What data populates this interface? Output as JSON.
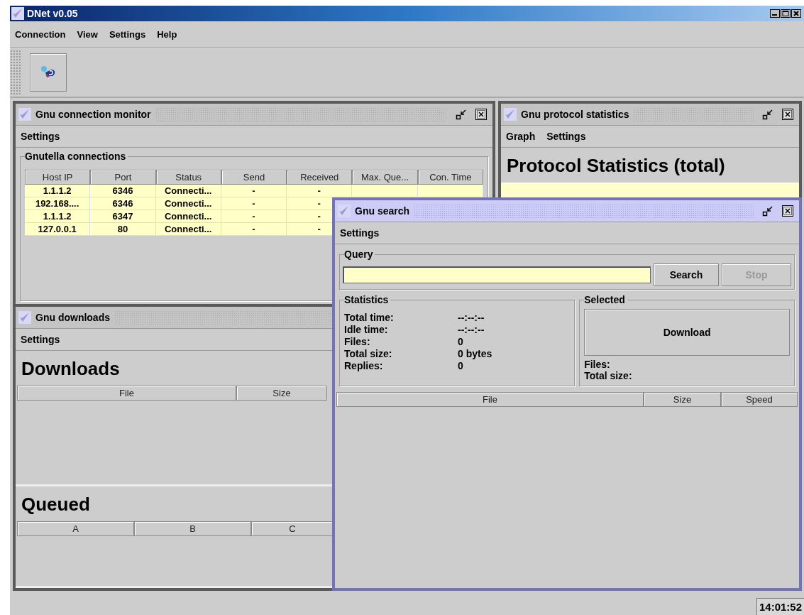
{
  "window": {
    "title": "DNet v0.05"
  },
  "menu": [
    "Connection",
    "View",
    "Settings",
    "Help"
  ],
  "frames": [
    {
      "kind": "connections",
      "title": "Gnu connection monitor",
      "active": false,
      "menu": [
        "Settings"
      ],
      "group": "Gnutella connections",
      "columns": [
        "Host IP",
        "Port",
        "Status",
        "Send",
        "Received",
        "Max. Que...",
        "Con. Time"
      ],
      "rows": [
        [
          "1.1.1.2",
          "6346",
          "Connecti...",
          "-",
          "-"
        ],
        [
          "192.168....",
          "6346",
          "Connecti...",
          "-",
          "-"
        ],
        [
          "1.1.1.2",
          "6347",
          "Connecti...",
          "-",
          "-"
        ],
        [
          "127.0.0.1",
          "80",
          "Connecti...",
          "-",
          "-"
        ]
      ]
    },
    {
      "kind": "protocol",
      "title": "Gnu protocol statistics",
      "active": false,
      "menu": [
        "Graph",
        "Settings"
      ],
      "heading": "Protocol Statistics (total)"
    },
    {
      "kind": "downloads",
      "title": "Gnu downloads",
      "active": false,
      "menu": [
        "Settings"
      ],
      "sections": [
        {
          "heading": "Downloads",
          "columns": [
            "File",
            "Size"
          ]
        },
        {
          "heading": "Queued",
          "columns": [
            "A",
            "B",
            "C"
          ]
        }
      ]
    },
    {
      "kind": "search",
      "title": "Gnu search",
      "active": true,
      "menu": [
        "Settings"
      ],
      "query_group": "Query",
      "buttons": [
        {
          "label": "Search",
          "disabled": false
        },
        {
          "label": "Stop",
          "disabled": true
        }
      ],
      "statistics": {
        "title": "Statistics",
        "rows": [
          {
            "label": "Total time:",
            "value": "--:--:--"
          },
          {
            "label": "Idle time:",
            "value": "--:--:--"
          },
          {
            "label": "Files:",
            "value": "0"
          },
          {
            "label": "Total size:",
            "value": "0 bytes"
          },
          {
            "label": "Replies:",
            "value": "0"
          }
        ]
      },
      "selected": {
        "title": "Selected",
        "button": "Download",
        "rows": [
          "Files:",
          "Total size:"
        ]
      },
      "columns": [
        "File",
        "Size",
        "Speed"
      ]
    }
  ],
  "status_bar": {
    "clock": "14:01:52"
  }
}
